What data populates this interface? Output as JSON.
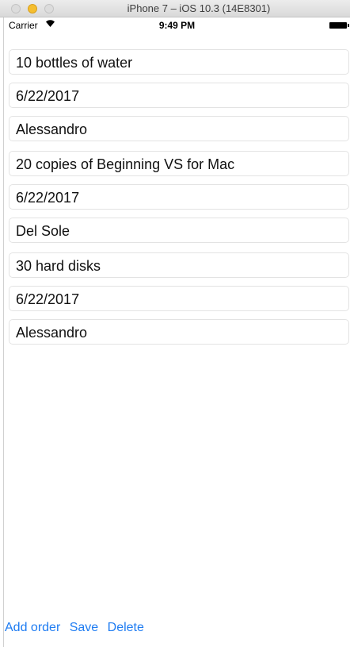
{
  "window": {
    "title": "iPhone 7 – iOS 10.3 (14E8301)"
  },
  "status_bar": {
    "carrier": "Carrier",
    "wifi_icon": "wifi-icon",
    "time": "9:49 PM",
    "battery_icon": "battery-icon"
  },
  "orders": [
    {
      "description": "10 bottles of water",
      "date": "6/22/2017",
      "customer": "Alessandro"
    },
    {
      "description": "20 copies of Beginning VS for Mac",
      "date": "6/22/2017",
      "customer": "Del Sole"
    },
    {
      "description": "30 hard disks",
      "date": "6/22/2017",
      "customer": "Alessandro"
    }
  ],
  "toolbar": {
    "add_label": "Add order",
    "save_label": "Save",
    "delete_label": "Delete",
    "accent_color": "#1e7cf2"
  }
}
